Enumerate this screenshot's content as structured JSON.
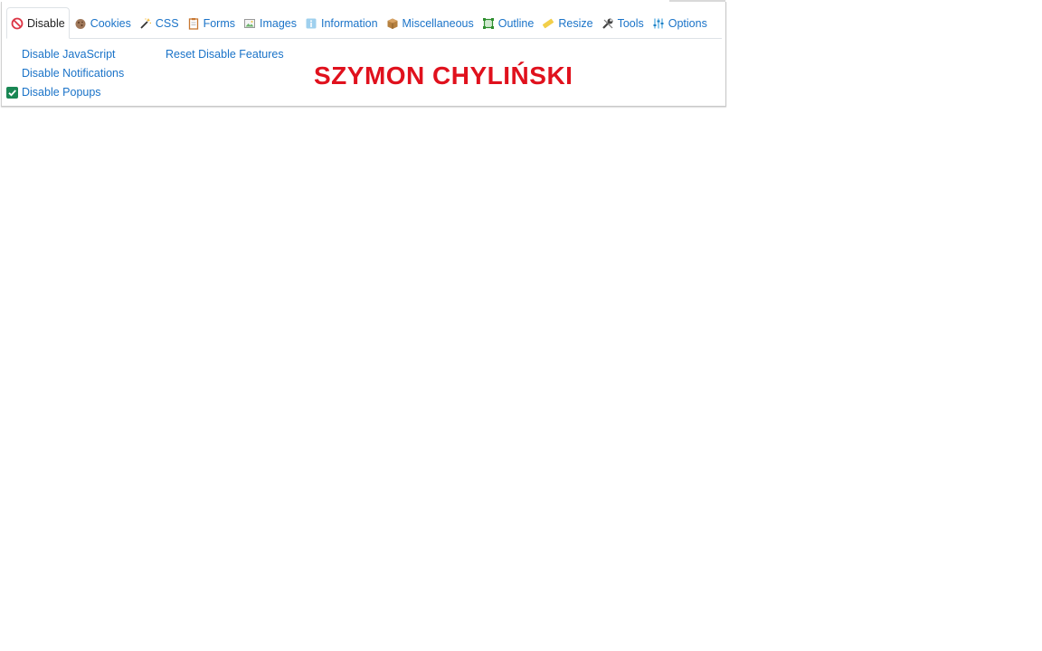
{
  "tabs": [
    {
      "label": "Disable",
      "icon": "disable-icon",
      "active": true
    },
    {
      "label": "Cookies",
      "icon": "cookie-icon"
    },
    {
      "label": "CSS",
      "icon": "magic-wand-icon"
    },
    {
      "label": "Forms",
      "icon": "clipboard-icon"
    },
    {
      "label": "Images",
      "icon": "image-icon"
    },
    {
      "label": "Information",
      "icon": "info-icon"
    },
    {
      "label": "Miscellaneous",
      "icon": "package-icon"
    },
    {
      "label": "Outline",
      "icon": "outline-icon"
    },
    {
      "label": "Resize",
      "icon": "ruler-icon"
    },
    {
      "label": "Tools",
      "icon": "wrench-icon"
    },
    {
      "label": "Options",
      "icon": "sliders-icon"
    }
  ],
  "disable_panel": {
    "disable_javascript": "Disable JavaScript",
    "disable_notifications": "Disable Notifications",
    "disable_popups": "Disable Popups",
    "disable_popups_checked": true,
    "reset_disable_features": "Reset Disable Features"
  },
  "watermark": "SZYMON CHYLIŃSKI",
  "colors": {
    "link": "#1a73c8",
    "check": "#198754",
    "watermark": "#e0111d",
    "disable_icon": "#dc3545"
  }
}
